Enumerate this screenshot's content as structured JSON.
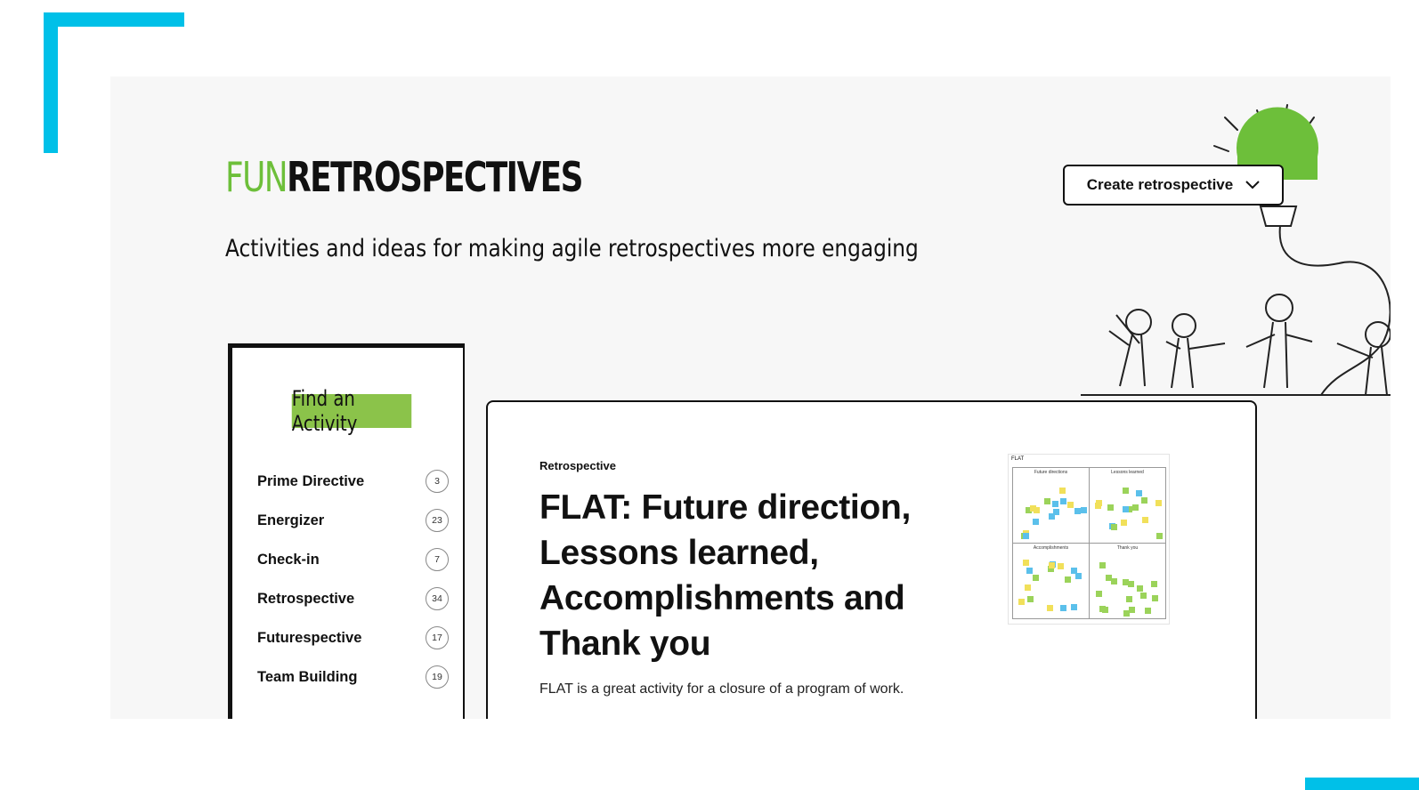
{
  "brand": {
    "logo_fun": "FUN",
    "logo_retro": "RETROSPECTIVES",
    "tagline": "Activities and ideas for making agile retrospectives more engaging",
    "accent_green": "#6dbf3a",
    "accent_cyan": "#00c0e8"
  },
  "header": {
    "create_button_label": "Create retrospective",
    "create_button_icon": "chevron-down-icon"
  },
  "sidebar": {
    "title": "Find an Activity",
    "categories": [
      {
        "label": "Prime Directive",
        "count": "3"
      },
      {
        "label": "Energizer",
        "count": "23"
      },
      {
        "label": "Check-in",
        "count": "7"
      },
      {
        "label": "Retrospective",
        "count": "34"
      },
      {
        "label": "Futurespective",
        "count": "17"
      },
      {
        "label": "Team Building",
        "count": "19"
      }
    ]
  },
  "featured": {
    "category": "Retrospective",
    "title": "FLAT: Future direction, Lessons learned, Accomplishments and Thank you",
    "description": "FLAT is a great activity for a closure of a program of work.",
    "thumbnail": {
      "board_title": "FLAT",
      "quadrants": [
        "Future directions",
        "Lessons learned",
        "Accomplishments",
        "Thank you"
      ]
    }
  }
}
